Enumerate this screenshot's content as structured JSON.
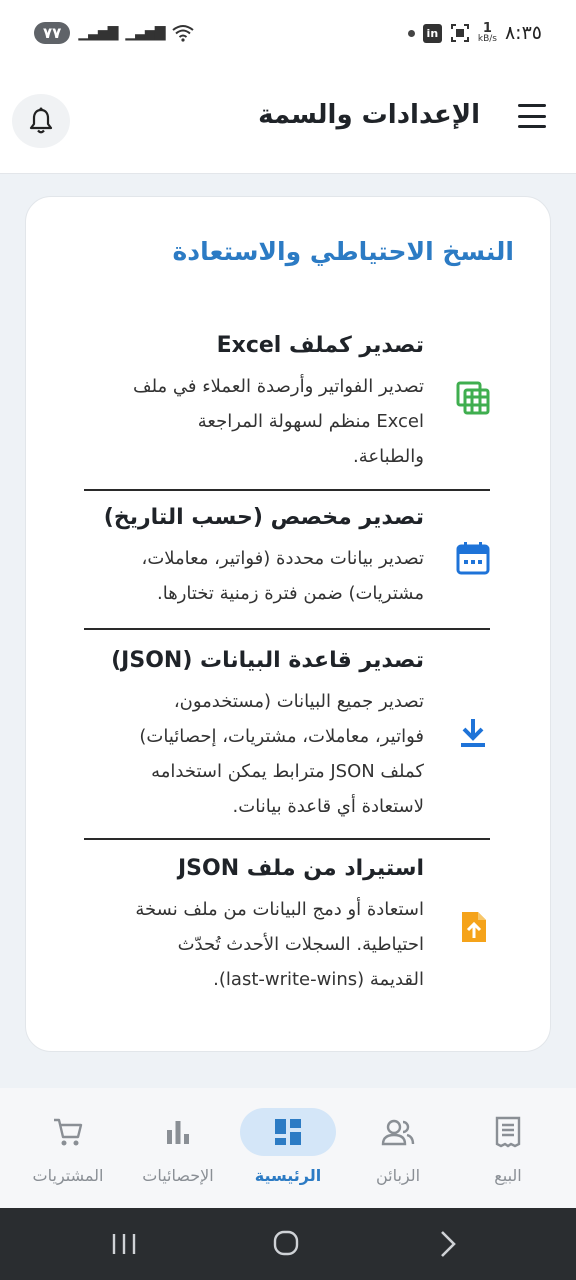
{
  "status_bar": {
    "time": "٨:٣٥",
    "battery": "٧٧",
    "speed_value": "1",
    "speed_unit": "kB/s"
  },
  "header": {
    "title": "الإعدادات والسمة"
  },
  "backup": {
    "section_title": "النسخ الاحتياطي والاستعادة",
    "options": [
      {
        "title": "تصدير كملف Excel",
        "description_lines": [
          "تصدير الفواتير وأرصدة العملاء في ملف",
          "Excel منظم لسهولة المراجعة",
          "والطباعة."
        ],
        "icon": "spreadsheet-icon",
        "color": "#3fae4f"
      },
      {
        "title": "تصدير مخصص (حسب التاريخ)",
        "description_lines": [
          "تصدير بيانات محددة (فواتير، معاملات،",
          "مشتريات) ضمن فترة زمنية تختارها."
        ],
        "icon": "calendar-icon",
        "color": "#1e73d8"
      },
      {
        "title": "تصدير قاعدة البيانات (JSON)",
        "description_lines": [
          "تصدير جميع البيانات (مستخدمون،",
          "فواتير، معاملات، مشتريات، إحصائيات)",
          "كملف JSON مترابط يمكن استخدامه",
          "لاستعادة أي قاعدة بيانات."
        ],
        "icon": "download-icon",
        "color": "#1e73d8"
      },
      {
        "title": "استيراد من ملف JSON",
        "description_lines": [
          "استعادة أو دمج البيانات من ملف نسخة",
          "احتياطية. السجلات الأحدث تُحدّث",
          "القديمة (last-write-wins)."
        ],
        "icon": "file-upload-icon",
        "color": "#f5a31a"
      }
    ]
  },
  "bottom_nav": {
    "items": [
      {
        "label": "البيع",
        "icon": "receipt-icon"
      },
      {
        "label": "الزبائن",
        "icon": "people-icon"
      },
      {
        "label": "الرئيسية",
        "icon": "dashboard-icon",
        "active": true
      },
      {
        "label": "الإحصائيات",
        "icon": "bar-chart-icon"
      },
      {
        "label": "المشتريات",
        "icon": "cart-icon"
      }
    ]
  },
  "colors": {
    "accent": "#2c7bc4",
    "active_pill": "#d4e6f8",
    "nav_inactive": "#8a8f95"
  }
}
